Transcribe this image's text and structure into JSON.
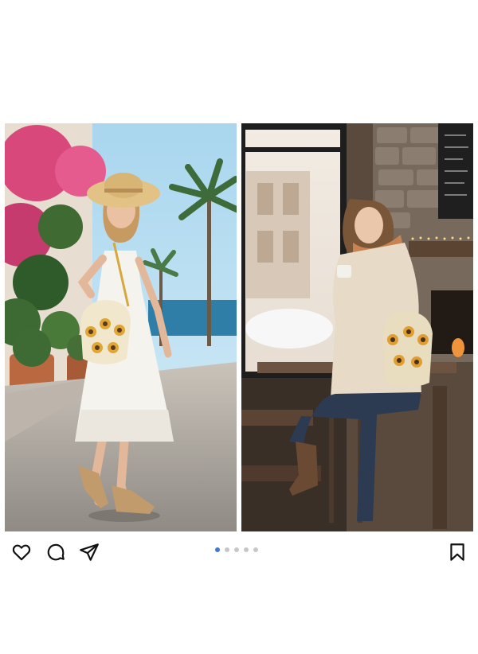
{
  "post": {
    "images": [
      {
        "name": "summer-white-dress-photo"
      },
      {
        "name": "cafe-sweater-photo"
      }
    ],
    "carousel": {
      "total": 5,
      "current": 1
    }
  },
  "actions": {
    "like_icon": "heart-icon",
    "comment_icon": "comment-icon",
    "share_icon": "share-icon",
    "save_icon": "bookmark-icon"
  },
  "colors": {
    "accent": "#3e78d8",
    "icon": "#111111"
  }
}
